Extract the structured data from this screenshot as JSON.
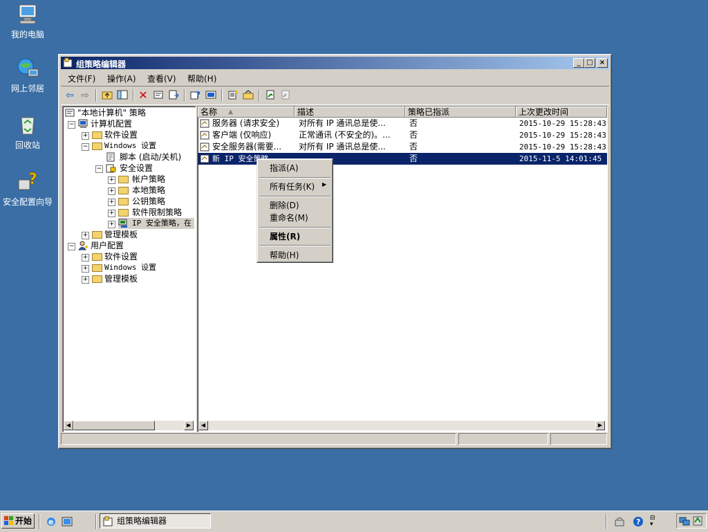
{
  "desktop": {
    "icons": [
      {
        "label": "我的电脑",
        "icon": "my-computer-icon"
      },
      {
        "label": "网上邻居",
        "icon": "network-places-icon"
      },
      {
        "label": "回收站",
        "icon": "recycle-bin-icon"
      },
      {
        "label": "安全配置向导",
        "icon": "security-wizard-icon"
      }
    ],
    "bg_color": "#3a6ea5"
  },
  "window": {
    "title": "组策略编辑器",
    "controls": [
      "_",
      "□",
      "×"
    ],
    "menu": [
      "文件(F)",
      "操作(A)",
      "查看(V)",
      "帮助(H)"
    ],
    "tree": {
      "root": "\"本地计算机\" 策略",
      "nodes": [
        {
          "label": "计算机配置"
        },
        {
          "label": "软件设置"
        },
        {
          "label": "Windows 设置"
        },
        {
          "label": "脚本 (启动/关机)"
        },
        {
          "label": "安全设置"
        },
        {
          "label": "帐户策略"
        },
        {
          "label": "本地策略"
        },
        {
          "label": "公钥策略"
        },
        {
          "label": "软件限制策略"
        },
        {
          "label": "IP 安全策略，在"
        },
        {
          "label": "管理模板"
        },
        {
          "label": "用户配置"
        },
        {
          "label": "软件设置"
        },
        {
          "label": "Windows 设置"
        },
        {
          "label": "管理模板"
        }
      ]
    },
    "list": {
      "columns": [
        "名称",
        "描述",
        "策略已指派",
        "上次更改时间"
      ],
      "rows": [
        {
          "name": "服务器 (请求安全)",
          "desc": "对所有 IP 通讯总是使...",
          "assigned": "否",
          "modified": "2015-10-29 15:28:43"
        },
        {
          "name": "客户端 (仅响应)",
          "desc": "正常通讯 (不安全的)。...",
          "assigned": "否",
          "modified": "2015-10-29 15:28:43"
        },
        {
          "name": "安全服务器(需要...",
          "desc": "对所有 IP 通讯总是使...",
          "assigned": "否",
          "modified": "2015-10-29 15:28:43"
        },
        {
          "name": "新 IP 安全策略",
          "desc": "",
          "assigned": "否",
          "modified": "2015-11-5 14:01:45"
        }
      ]
    },
    "context_menu": {
      "items": [
        "指派(A)",
        "所有任务(K)",
        "删除(D)",
        "重命名(M)",
        "属性(R)",
        "帮助(H)"
      ]
    }
  },
  "taskbar": {
    "start_label": "开始",
    "window_button": "组策略编辑器"
  },
  "colors": {
    "selection": "#0a246a",
    "title_start": "#0a246a",
    "title_end": "#a6caf0",
    "face": "#d4d0c8"
  }
}
